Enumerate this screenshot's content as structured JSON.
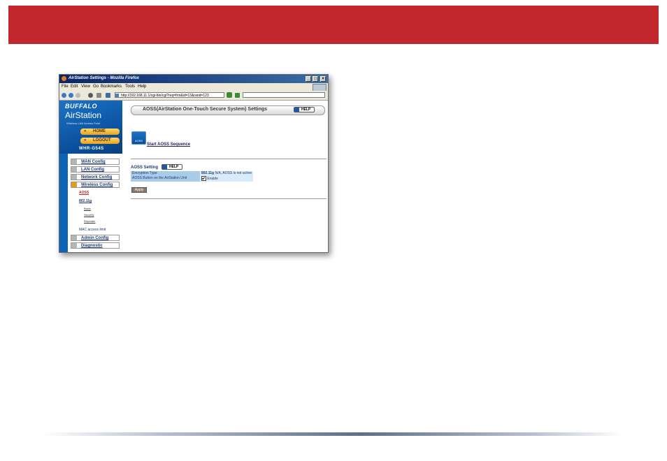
{
  "window": {
    "title": "AirStation Settings - Mozilla Firefox",
    "controls": [
      "_",
      "□",
      "×"
    ]
  },
  "menubar": [
    "File",
    "Edit",
    "View",
    "Go",
    "Bookmarks",
    "Tools",
    "Help"
  ],
  "address": {
    "url": "http://192.168.11.1/cgi-bin/cgi?req=frm&id=13&rand=123"
  },
  "sidebar": {
    "brand": "BUFFALO",
    "product": "AirStation",
    "tagline": "Wireless LAN Access Point",
    "home_label": "HOME",
    "logout_label": "LOGOUT",
    "model": "WHR-G54S",
    "menu": [
      {
        "label": "WAN Config"
      },
      {
        "label": "LAN Config"
      },
      {
        "label": "Network Config"
      },
      {
        "label": "Wireless Config"
      }
    ],
    "submenu": {
      "aoss": "AOSS",
      "band": "802.11g",
      "basic": "Basic",
      "security": "Security",
      "repeater": "Repeater",
      "mac": "MAC access limit"
    },
    "menu_bottom": [
      {
        "label": "Admin Config"
      },
      {
        "label": "Diagnostic"
      }
    ]
  },
  "content": {
    "page_title": "AOSS(AirStation One-Touch Secure System) Settings",
    "help_label": "HELP",
    "aoss_icon_text": "AOSS",
    "start_link": "Start AOSS Sequence",
    "section_title": "AOSS Setting",
    "rows": [
      {
        "key": "Encryption Type",
        "value_bold": "802.11g",
        "value": "N/A, AOSS is not active"
      },
      {
        "key": "AOSS Button on the AirStation Unit",
        "value_bold": "",
        "value": "Enable"
      }
    ],
    "apply_label": "Apply"
  },
  "colors": {
    "banner": "#c1272d",
    "sidebar_blue": "#0d63b8",
    "accent_orange": "#e8a318"
  }
}
